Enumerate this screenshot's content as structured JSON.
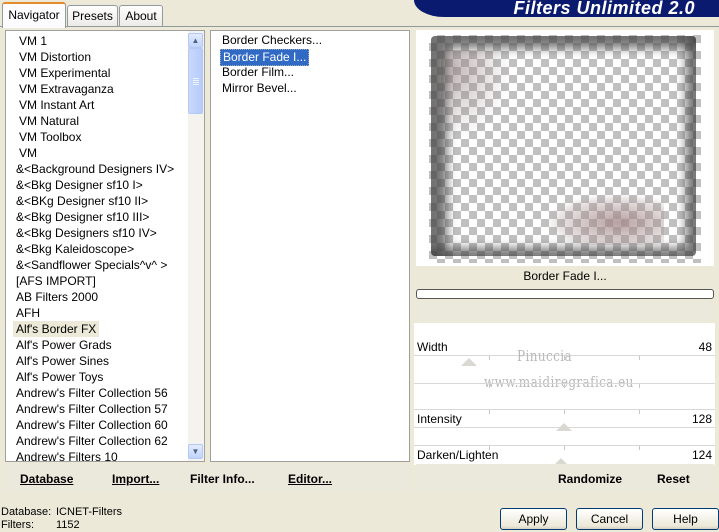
{
  "tabs": [
    {
      "label": "Navigator",
      "active": true
    },
    {
      "label": "Presets",
      "active": false
    },
    {
      "label": "About",
      "active": false
    }
  ],
  "brand": "Filters Unlimited 2.0",
  "categories": [
    "VM 1",
    "VM Distortion",
    "VM Experimental",
    "VM Extravaganza",
    "VM Instant Art",
    "VM Natural",
    "VM Toolbox",
    "VM",
    "&<Background Designers IV>",
    "&<Bkg Designer sf10 I>",
    "&<BKg Designer sf10 II>",
    "&<Bkg Designer sf10 III>",
    "&<Bkg Designers sf10 IV>",
    "&<Bkg Kaleidoscope>",
    "&<Sandflower Specials^v^ >",
    "[AFS IMPORT]",
    "AB Filters 2000",
    "AFH",
    "Alf's Border FX",
    "Alf's Power Grads",
    "Alf's Power Sines",
    "Alf's Power Toys",
    "Andrew's Filter Collection 56",
    "Andrew's Filter Collection 57",
    "Andrew's Filter Collection 60",
    "Andrew's Filter Collection 62",
    "Andrew's Filters 10"
  ],
  "selected_category": "Alf's Border FX",
  "filters": [
    "Border Checkers...",
    "Border Fade I...",
    "Border Film...",
    "Mirror Bevel..."
  ],
  "selected_filter": "Border Fade I...",
  "preview_filter_name": "Border Fade I...",
  "controls": [
    {
      "label": "Width",
      "value": "48"
    },
    {
      "label": "Intensity",
      "value": "128"
    },
    {
      "label": "Darken/Lighten",
      "value": "124"
    }
  ],
  "watermark": {
    "line1": "Pinuccia",
    "line2": "www.maidiregrafica.eu"
  },
  "bottom_buttons": {
    "database": "Database",
    "import": "Import...",
    "filter_info": "Filter Info...",
    "editor": "Editor..."
  },
  "right_buttons": {
    "randomize": "Randomize",
    "reset": "Reset"
  },
  "info": {
    "database_label": "Database:",
    "database_value": "ICNET-Filters",
    "filters_label": "Filters:",
    "filters_value": "1152"
  },
  "dialog_buttons": {
    "apply": "Apply",
    "cancel": "Cancel",
    "help": "Help"
  }
}
